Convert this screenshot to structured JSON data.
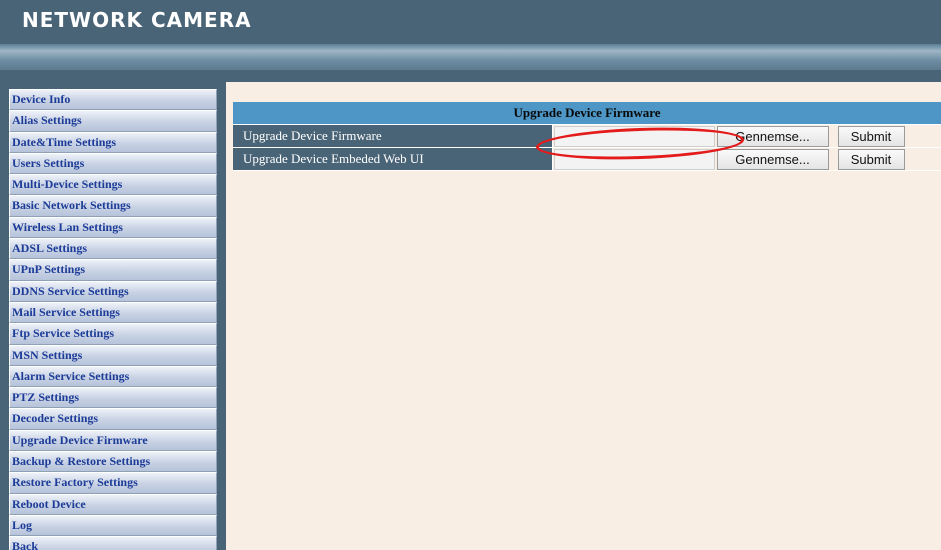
{
  "header": {
    "brand": "NETWORK CAMERA"
  },
  "sidebar": {
    "items": [
      {
        "label": "Device Info"
      },
      {
        "label": "Alias Settings"
      },
      {
        "label": "Date&Time Settings"
      },
      {
        "label": "Users Settings"
      },
      {
        "label": "Multi-Device Settings"
      },
      {
        "label": "Basic Network Settings"
      },
      {
        "label": "Wireless Lan Settings"
      },
      {
        "label": "ADSL Settings"
      },
      {
        "label": "UPnP Settings"
      },
      {
        "label": "DDNS Service Settings"
      },
      {
        "label": "Mail Service Settings"
      },
      {
        "label": "Ftp Service Settings"
      },
      {
        "label": "MSN Settings"
      },
      {
        "label": "Alarm Service Settings"
      },
      {
        "label": "PTZ Settings"
      },
      {
        "label": "Decoder Settings"
      },
      {
        "label": "Upgrade Device Firmware"
      },
      {
        "label": "Backup & Restore Settings"
      },
      {
        "label": "Restore Factory Settings"
      },
      {
        "label": "Reboot Device"
      },
      {
        "label": "Log"
      },
      {
        "label": "Back"
      }
    ]
  },
  "main": {
    "title": "Upgrade Device Firmware",
    "rows": [
      {
        "label": "Upgrade Device Firmware",
        "file_value": "",
        "browse_label": "Gennemse...",
        "submit_label": "Submit"
      },
      {
        "label": "Upgrade Device Embeded Web UI",
        "file_value": "",
        "browse_label": "Gennemse...",
        "submit_label": "Submit"
      }
    ]
  },
  "colors": {
    "header_bg": "#4a6477",
    "nav_text": "#1c3c98",
    "table_title_bg": "#4e96c5",
    "content_bg": "#f9eee3",
    "annotation": "#e31b1b"
  }
}
